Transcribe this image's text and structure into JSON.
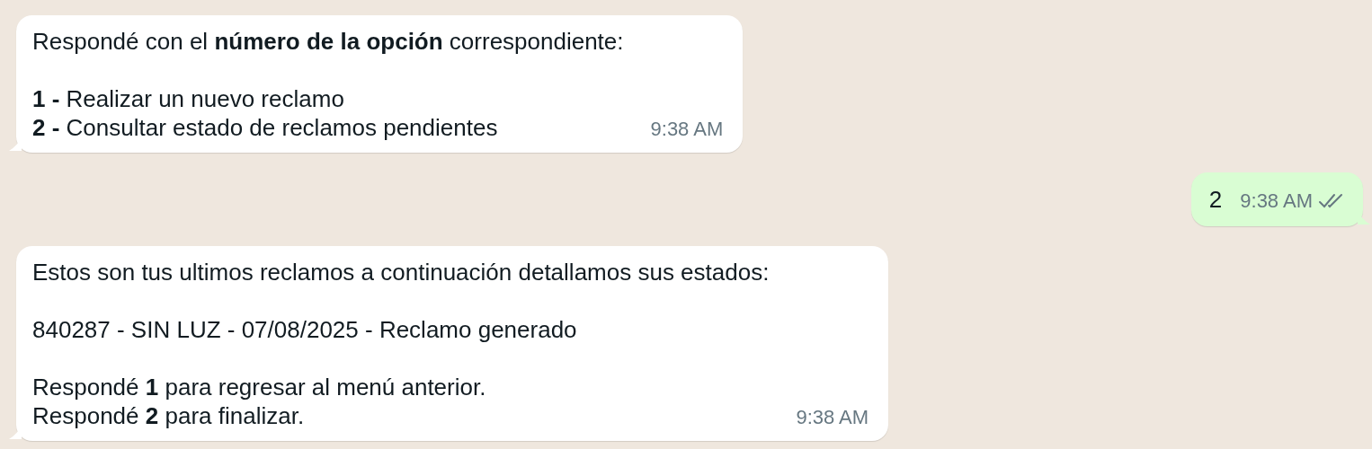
{
  "messages": [
    {
      "kind": "incoming",
      "paragraphs": [
        [
          "Respondé con el **número de la opción** correspondiente:"
        ],
        [
          "**1 -** Realizar un nuevo reclamo",
          "**2 -** Consultar estado de reclamos pendientes"
        ]
      ],
      "time": "9:38 AM"
    },
    {
      "kind": "outgoing",
      "paragraphs": [
        [
          "2"
        ]
      ],
      "time": "9:38 AM",
      "read": false
    },
    {
      "kind": "incoming",
      "paragraphs": [
        [
          "Estos son tus ultimos reclamos a continuación detallamos sus estados:"
        ],
        [
          "840287 - SIN LUZ - 07/08/2025 - Reclamo generado"
        ],
        [
          "Respondé **1** para regresar al menú anterior.",
          "Respondé **2** para finalizar."
        ]
      ],
      "time": "9:38 AM"
    }
  ]
}
